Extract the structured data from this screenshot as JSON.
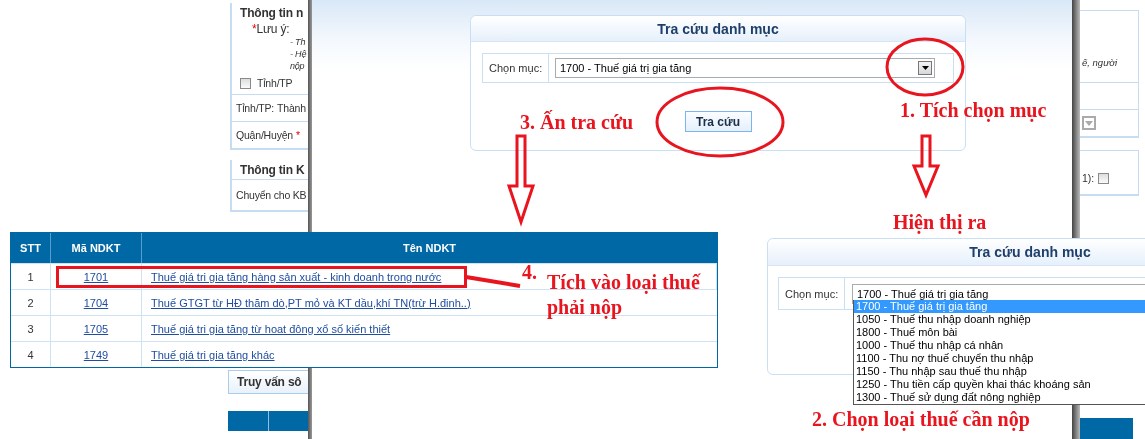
{
  "background_form": {
    "section_title": "Thông tin n",
    "note": {
      "required_mark": "*",
      "label": "Lưu ý:"
    },
    "note_lines": [
      "- Th",
      "- Hệ",
      "nộp"
    ],
    "province_checkbox": {
      "label": "Tỉnh/TP",
      "checked": false
    },
    "province_field": {
      "label": "Tỉnh/TP:",
      "value": "Thành"
    },
    "district_field": {
      "label": "Quận/Huyện",
      "required_mark": "*"
    },
    "second_section_title": "Thông tin K",
    "transfer_label": "Chuyển cho KB",
    "query_title": "Truy vấn sô"
  },
  "background_form_right": {
    "note_tail": "ế, người",
    "checkbox": {
      "label": "1):",
      "checked": false
    }
  },
  "lookup_dialog": {
    "title": "Tra cứu danh mục",
    "field_label": "Chọn mục:",
    "value": "1700 - Thuế giá trị gia tăng",
    "button": "Tra cứu"
  },
  "result_table": {
    "columns": [
      "STT",
      "Mã NDKT",
      "Tên NDKT"
    ],
    "rows": [
      {
        "stt": "1",
        "code": "1701",
        "name": "Thuế giá tri gia tăng hàng sản xuất - kinh doanh trong nước",
        "highlighted": true
      },
      {
        "stt": "2",
        "code": "1704",
        "name": "Thuế GTGT từ HĐ thăm dò,PT mỏ và KT dầu,khí TN(trừ H.đinh..)",
        "highlighted": false
      },
      {
        "stt": "3",
        "code": "1705",
        "name": "Thuế giá tri gia tăng từ hoat đông xổ số kiến thiết",
        "highlighted": false
      },
      {
        "stt": "4",
        "code": "1749",
        "name": "Thuế giá tri gia tăng khác",
        "highlighted": false
      }
    ]
  },
  "dropdown_panel": {
    "title": "Tra cứu danh mục",
    "field_label": "Chọn mục:",
    "value": "1700 - Thuế giá trị gia tăng",
    "options": [
      {
        "label": "1700 - Thuế giá trị gia tăng",
        "selected": true
      },
      {
        "label": "1050 - Thuế thu nhập doanh nghiệp",
        "selected": false
      },
      {
        "label": "1800 - Thuế môn bài",
        "selected": false
      },
      {
        "label": "1000 - Thuế thu nhập cá nhân",
        "selected": false
      },
      {
        "label": "1100 - Thu nợ thuế chuyển thu nhập",
        "selected": false
      },
      {
        "label": "1150 - Thu nhập sau thuế thu nhập",
        "selected": false
      },
      {
        "label": "1250 - Thu tiền cấp quyền khai thác khoáng sản",
        "selected": false
      },
      {
        "label": "1300 - Thuế sử dụng đất nông nghiệp",
        "selected": false
      }
    ]
  },
  "annotations": [
    "3. Ấn tra cứu",
    "1. Tích chọn mục",
    "Hiện thị ra",
    "4.",
    "Tích vào loại thuế phải nộp",
    "2. Chọn loại thuế cần nộp"
  ]
}
